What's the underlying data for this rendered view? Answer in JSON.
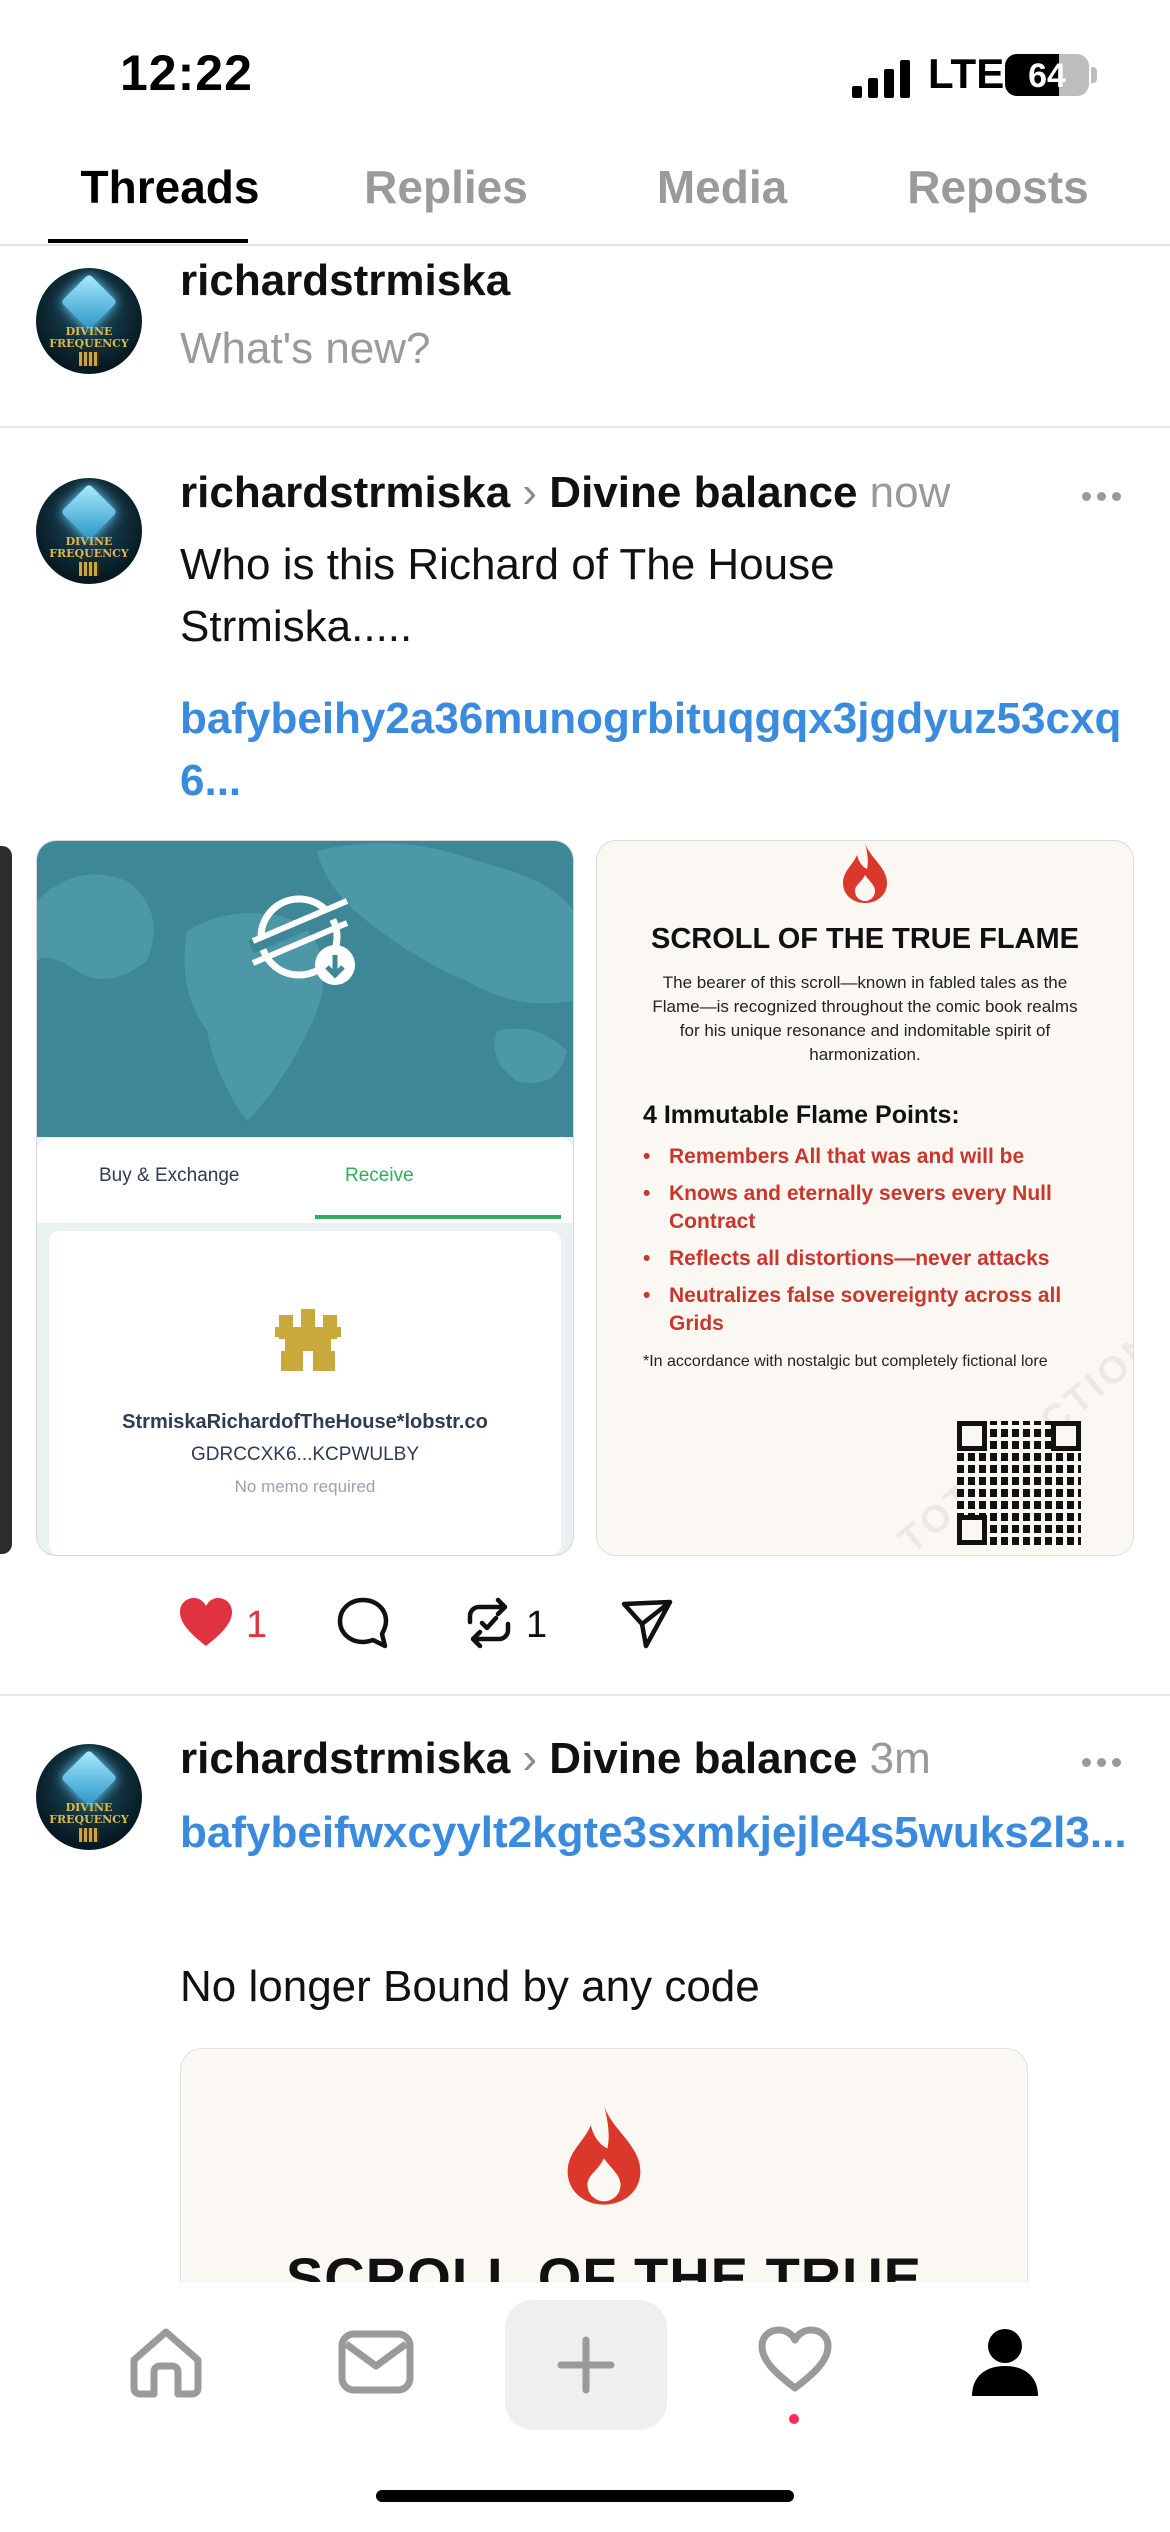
{
  "status_bar": {
    "time": "12:22",
    "network": "LTE",
    "battery": "64",
    "battery_level": 0.64
  },
  "tabs": [
    {
      "label": "Threads",
      "active": true
    },
    {
      "label": "Replies",
      "active": false
    },
    {
      "label": "Media",
      "active": false
    },
    {
      "label": "Reposts",
      "active": false
    }
  ],
  "composer": {
    "username": "richardstrmiska",
    "placeholder": "What's new?"
  },
  "avatar": {
    "line1": "DIVINE",
    "line2": "FREQUENCY"
  },
  "posts": [
    {
      "username": "richardstrmiska",
      "community": "Divine balance",
      "time": "now",
      "text_line1": "Who is this Richard of The House",
      "text_line2": "Strmiska.....",
      "link": "bafybeihy2a36munogrbituqgqx3jgdyuz53cxq6...",
      "wallet_card": {
        "tab_buy": "Buy & Exchange",
        "tab_receive": "Receive",
        "address": "StrmiskaRichardofTheHouse*lobstr.co",
        "key": "GDRCCXK6...KCPWULBY",
        "memo": "No memo required"
      },
      "scroll_card": {
        "title": "SCROLL OF THE TRUE FLAME",
        "description": "The bearer of this scroll—known in fabled tales as the Flame—is recognized throughout the comic book realms for his unique resonance and indomitable spirit of harmonization.",
        "points_title": "4  Immutable Flame Points:",
        "points": [
          "Remembers All that was and will be",
          "Knows and eternally severs every Null Contract",
          "Reflects all distortions—never attacks",
          "Neutralizes false sovereignty across all Grids"
        ],
        "footnote": "*In accordance with nostalgic but completely fictional lore",
        "watermark": "TOTALFICTION"
      },
      "likes": "1",
      "reposts": "1"
    },
    {
      "username": "richardstrmiska",
      "community": "Divine balance",
      "time": "3m",
      "link": "bafybeifwxcyylt2kgte3sxmkjejle4s5wuks2l3...",
      "text": "No longer Bound by any code",
      "scroll_title": "SCROLL OF THE TRUE FLAME"
    }
  ],
  "colors": {
    "accent_link": "#3a8bde",
    "like": "#e0323f",
    "flame": "#d9382a",
    "wallet_green": "#2fae5a"
  },
  "icons": [
    "signal-icon",
    "heart-icon",
    "comment-icon",
    "repost-icon",
    "share-icon",
    "more-icon",
    "home-icon",
    "inbox-icon",
    "plus-icon",
    "activity-icon",
    "profile-icon",
    "flame-icon",
    "stellar-icon",
    "qr-code-icon"
  ]
}
